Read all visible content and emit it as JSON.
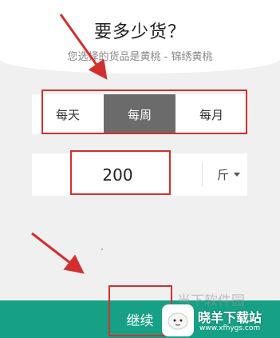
{
  "header": {
    "title": "要多少货？",
    "subtitle": "您选择的货品是黄桃 - 锦绣黄桃"
  },
  "frequency": {
    "options": [
      "每天",
      "每周",
      "每月"
    ],
    "selected": "每周"
  },
  "quantity": {
    "value": "200",
    "unit": "斤"
  },
  "actions": {
    "continue_label": "继续"
  },
  "colors": {
    "accent": "#16a085",
    "selected_segment": "#6b6b6b",
    "annotation": "#d32f2f"
  },
  "watermark": {
    "faint_text": "当下软件园",
    "brand": "晓羊下载站",
    "url": "www.xfhygs.com"
  }
}
